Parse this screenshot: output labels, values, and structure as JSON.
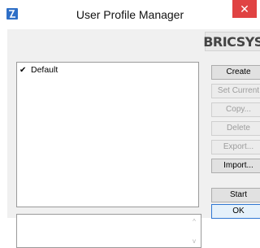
{
  "window": {
    "title": "User Profile Manager",
    "close_glyph": "✕",
    "app_icon": "bricscad-app-icon"
  },
  "logo": {
    "text": "BRICSYS"
  },
  "profiles": [
    {
      "check": "✔",
      "name": "Default",
      "checked": true
    }
  ],
  "buttons": {
    "create": "Create",
    "set_current": "Set Current",
    "copy": "Copy...",
    "delete": "Delete",
    "export": "Export...",
    "import": "Import...",
    "start": "Start",
    "ok": "OK"
  },
  "description_box": {
    "scroll_up": "^",
    "scroll_down": "v"
  },
  "colors": {
    "close": "#e04343",
    "accent": "#2f77d3",
    "app_icon": "#2e6fc7"
  }
}
